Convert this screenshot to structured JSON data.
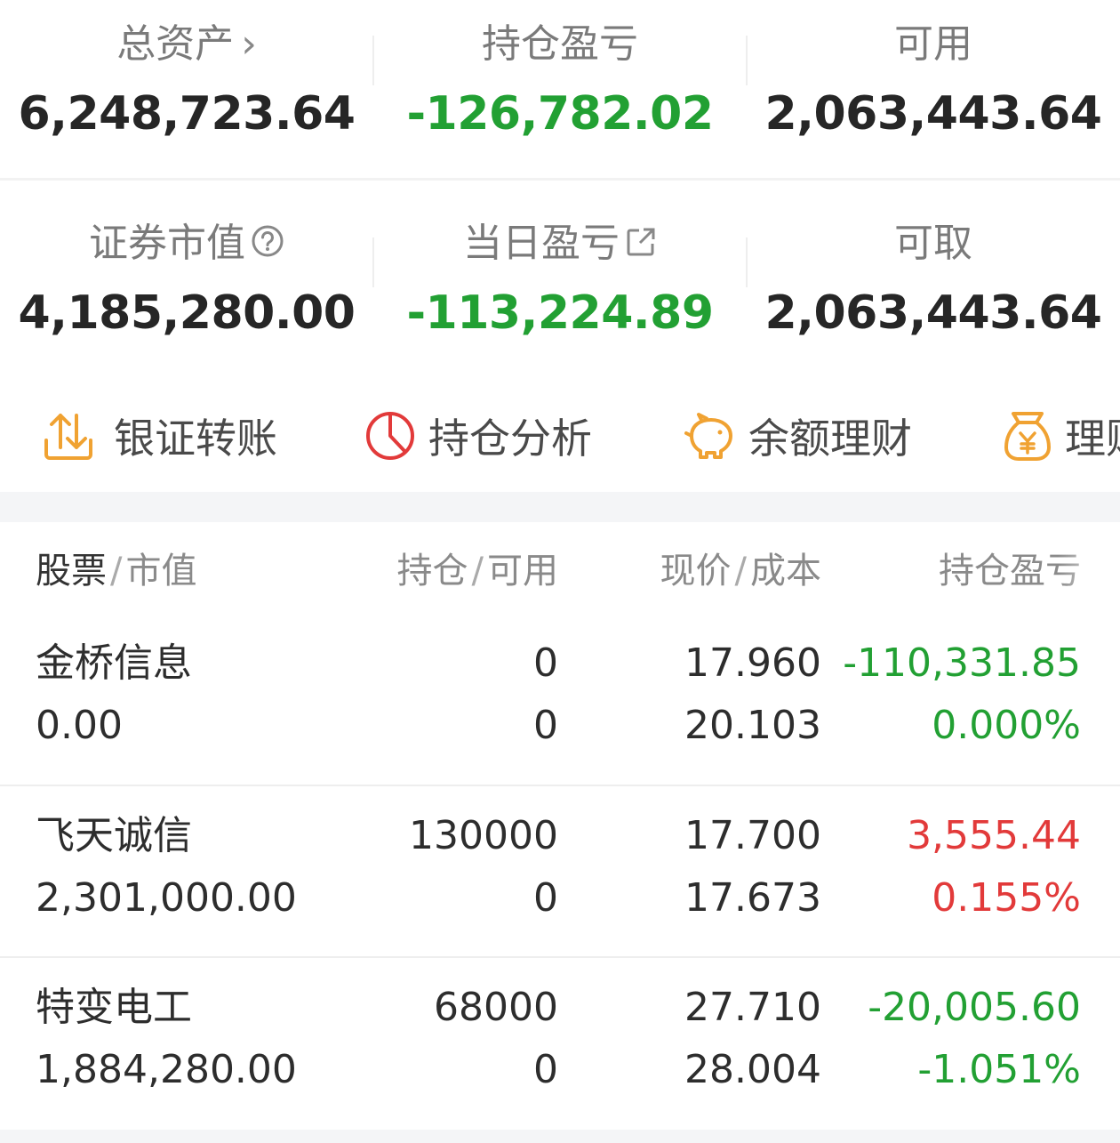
{
  "summary": {
    "total_assets": {
      "label": "总资产",
      "value": "6,248,723.64"
    },
    "position_pl": {
      "label": "持仓盈亏",
      "value": "-126,782.02"
    },
    "available": {
      "label": "可用",
      "value": "2,063,443.64"
    },
    "market_value": {
      "label": "证券市值",
      "value": "4,185,280.00"
    },
    "daily_pl": {
      "label": "当日盈亏",
      "value": "-113,224.89"
    },
    "withdrawable": {
      "label": "可取",
      "value": "2,063,443.64"
    }
  },
  "tools": [
    {
      "label": "银证转账",
      "icon": "transfer-icon"
    },
    {
      "label": "持仓分析",
      "icon": "pie-chart-icon"
    },
    {
      "label": "余额理财",
      "icon": "piggy-bank-icon"
    },
    {
      "label": "理财",
      "icon": "money-bag-icon"
    }
  ],
  "table": {
    "headers": {
      "stock": "股票",
      "market_value": "市值",
      "position": "持仓",
      "available": "可用",
      "price": "现价",
      "cost": "成本",
      "pl": "持仓盈亏"
    },
    "rows": [
      {
        "name": "金桥信息",
        "market_value": "0.00",
        "position": "0",
        "available": "0",
        "price": "17.960",
        "cost": "20.103",
        "pl": "-110,331.85",
        "pct": "0.000%",
        "trend": "down"
      },
      {
        "name": "飞天诚信",
        "market_value": "2,301,000.00",
        "position": "130000",
        "available": "0",
        "price": "17.700",
        "cost": "17.673",
        "pl": "3,555.44",
        "pct": "0.155%",
        "trend": "up"
      },
      {
        "name": "特变电工",
        "market_value": "1,884,280.00",
        "position": "68000",
        "available": "0",
        "price": "27.710",
        "cost": "28.004",
        "pl": "-20,005.60",
        "pct": "-1.051%",
        "trend": "down"
      }
    ]
  },
  "colors": {
    "loss": "#22a033",
    "gain": "#e23a3a",
    "accent": "#f0a232"
  }
}
